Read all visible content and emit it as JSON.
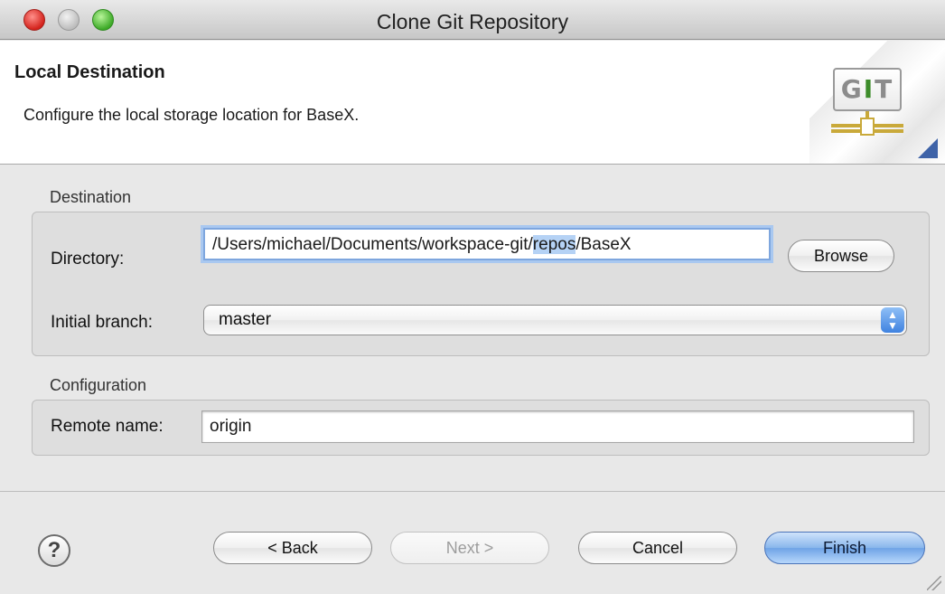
{
  "window": {
    "title": "Clone Git Repository"
  },
  "banner": {
    "title": "Local Destination",
    "description": "Configure the local storage location for BaseX.",
    "logo_text": "GIT",
    "logo_letters": [
      "G",
      "I",
      "T"
    ]
  },
  "destination": {
    "group_label": "Destination",
    "directory_label": "Directory:",
    "directory_value_prefix": "/Users/michael/Documents/workspace-git/",
    "directory_value_selected": "repos",
    "directory_value_suffix": "/BaseX",
    "browse_label": "Browse",
    "branch_label": "Initial branch:",
    "branch_value": "master"
  },
  "configuration": {
    "group_label": "Configuration",
    "remote_label": "Remote name:",
    "remote_value": "origin"
  },
  "footer": {
    "help_symbol": "?",
    "back_label": "< Back",
    "next_label": "Next >",
    "cancel_label": "Cancel",
    "finish_label": "Finish"
  },
  "colors": {
    "default_button": "#6ea3e6",
    "selection": "#b5d2f5",
    "focus_ring": "#a9c8f0"
  }
}
